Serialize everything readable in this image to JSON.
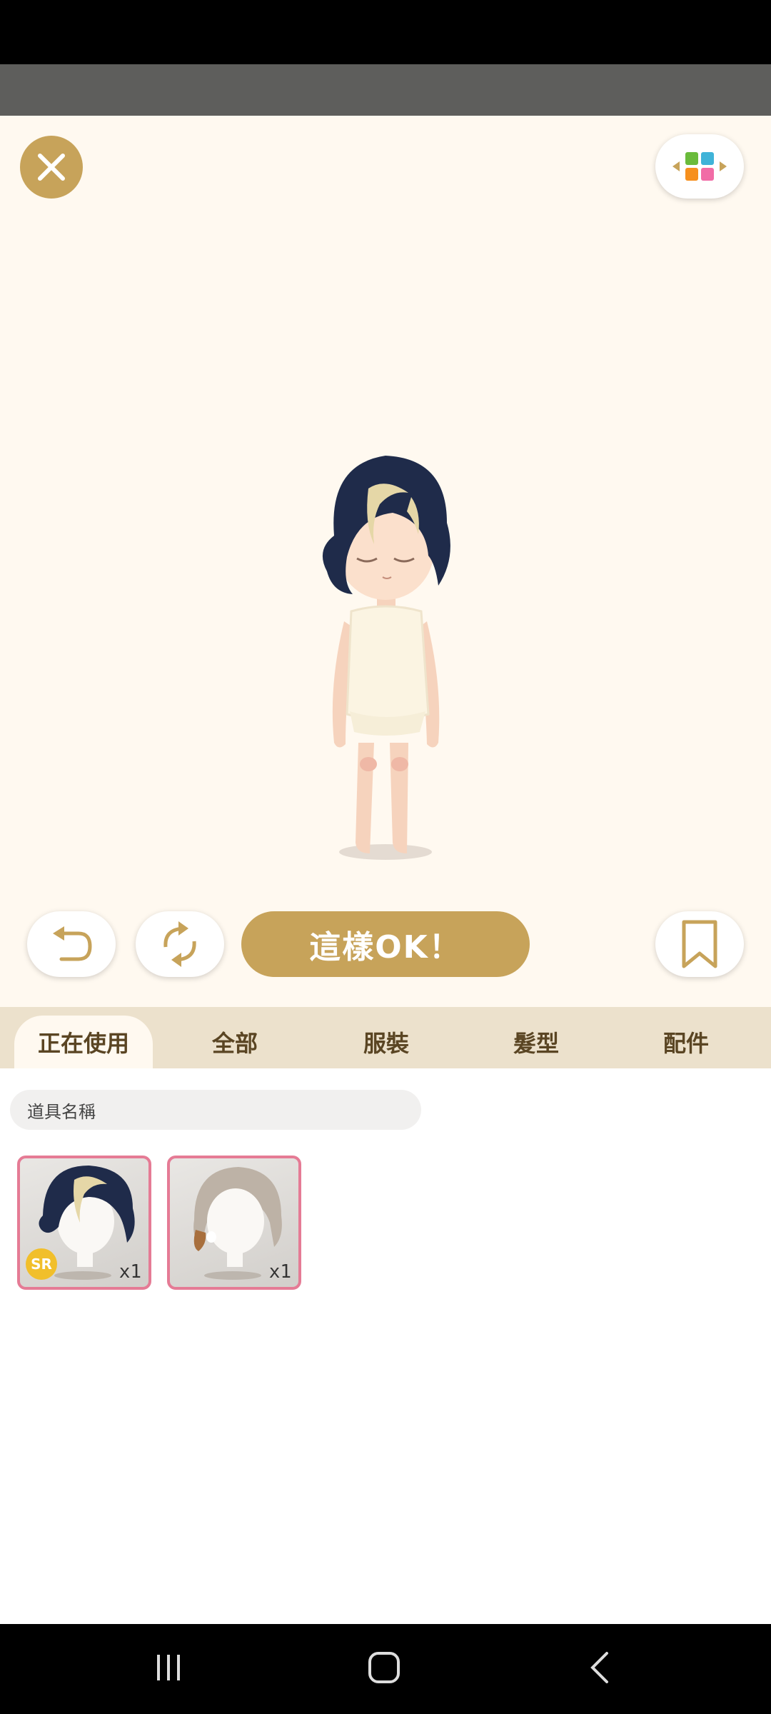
{
  "toolbar": {
    "ok_label": "這樣OK！"
  },
  "tabs": [
    {
      "label": "正在使用",
      "active": true
    },
    {
      "label": "全部",
      "active": false
    },
    {
      "label": "服裝",
      "active": false
    },
    {
      "label": "髮型",
      "active": false
    },
    {
      "label": "配件",
      "active": false
    }
  ],
  "search": {
    "placeholder": "道具名稱"
  },
  "items": [
    {
      "qty": "x1",
      "rarity": "SR",
      "hair_color": "#1f2b4a"
    },
    {
      "qty": "x1",
      "rarity": "",
      "hair_color": "#bdb2a6"
    }
  ],
  "colors": {
    "accent": "#c7a35a",
    "stage_bg": "#fff9f0",
    "tabbar_bg": "#ece1cc",
    "item_border": "#e57b95",
    "rarity_badge": "#f1bf2b"
  },
  "icons": {
    "close": "close-icon",
    "layout": "layout-switch-icon",
    "undo": "undo-icon",
    "refresh": "refresh-icon",
    "bookmark": "bookmark-icon",
    "nav_recent": "recent-apps-icon",
    "nav_home": "home-icon",
    "nav_back": "back-icon"
  }
}
